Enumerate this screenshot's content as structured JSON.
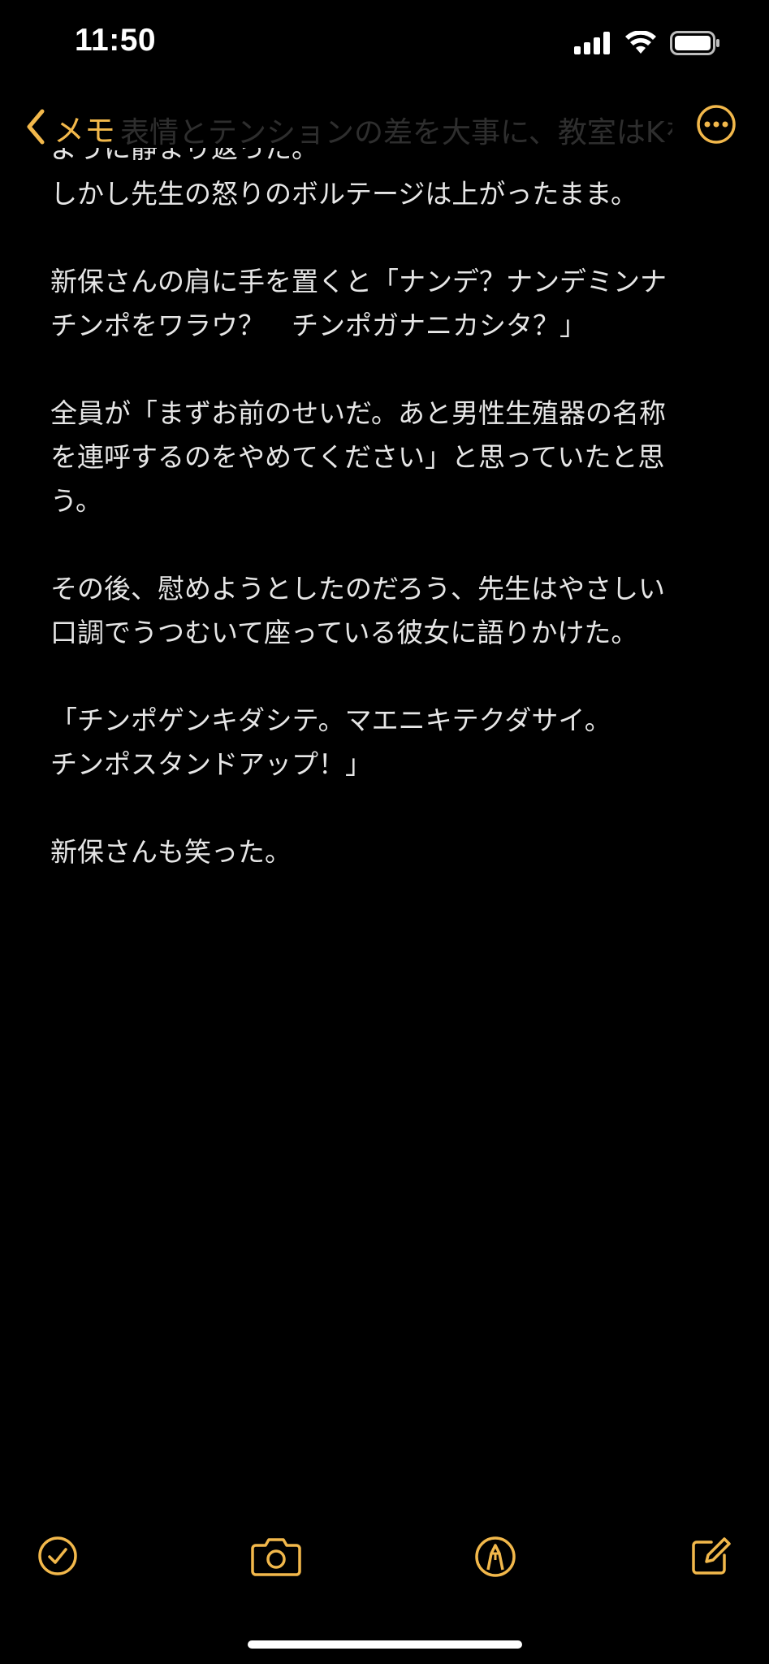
{
  "status_bar": {
    "time": "11:50"
  },
  "nav": {
    "back_label": "メモ",
    "faded_title": "表情とテンションの差を大事に、教室はKを打った"
  },
  "note": {
    "lines": [
      "ように静まり返った。",
      "しかし先生の怒りのボルテージは上がったまま。",
      "",
      "新保さんの肩に手を置くと「ナンデ？ナンデミンナ",
      "チンポをワラウ？　チンポガナニカシタ？」",
      "",
      "全員が「まずお前のせいだ。あと男性生殖器の名称",
      "を連呼するのをやめてください」と思っていたと思",
      "う。",
      "",
      "その後、慰めようとしたのだろう、先生はやさしい",
      "口調でうつむいて座っている彼女に語りかけた。",
      "",
      "「チンポゲンキダシテ。マエニキテクダサイ。",
      "チンポスタンドアップ！」",
      "",
      "新保さんも笑った。"
    ]
  },
  "icons": {
    "signal": "cellular-signal-icon",
    "wifi": "wifi-icon",
    "battery": "battery-icon",
    "back": "chevron-left-icon",
    "more": "ellipsis-circle-icon",
    "checklist": "checkmark-circle-icon",
    "camera": "camera-icon",
    "markup": "pen-circle-icon",
    "compose": "compose-icon"
  },
  "colors": {
    "accent": "#f2b84b",
    "background": "#000000",
    "text": "#e6e6e6"
  }
}
